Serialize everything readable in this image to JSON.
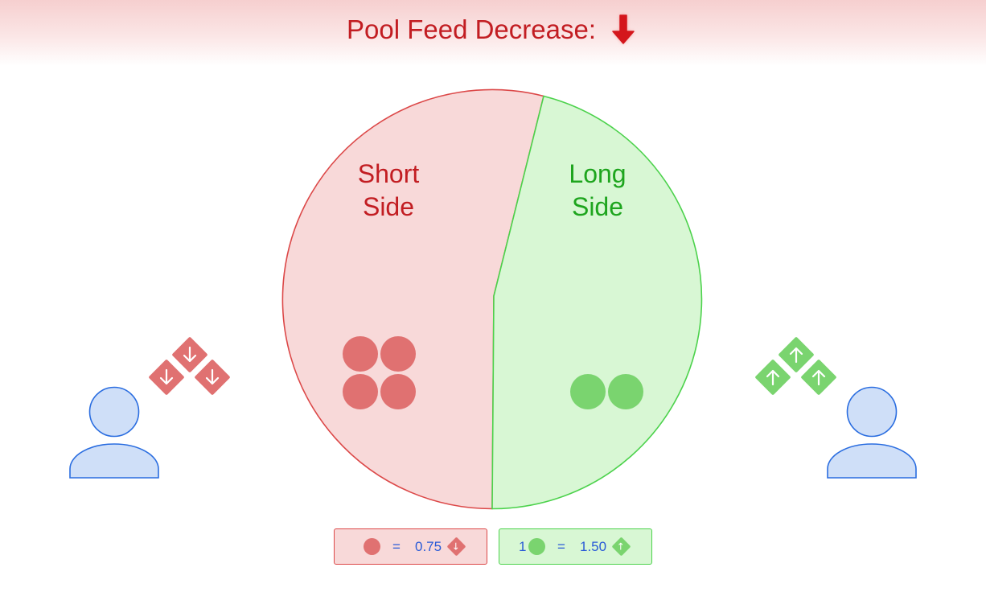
{
  "header": {
    "title": "Pool Feed Decrease:",
    "arrow_icon": "down-arrow-icon",
    "title_color": "#c21d22"
  },
  "pool": {
    "short_side": {
      "label_line1": "Short",
      "label_line2": "Side",
      "token_count": 4,
      "fill": "#f8d9d9",
      "stroke": "#dc4848",
      "text_color": "#c21d22",
      "token_color": "#e07171"
    },
    "long_side": {
      "label_line1": "Long",
      "label_line2": "Side",
      "token_count": 2,
      "fill": "#d8f7d4",
      "stroke": "#4cd24c",
      "text_color": "#1ea51e",
      "token_color": "#7ad46f"
    }
  },
  "traders": {
    "left": {
      "icon": "person-icon",
      "feed_icon": "down-arrow-diamond-icon",
      "feed_count": 3
    },
    "right": {
      "icon": "person-icon",
      "feed_icon": "up-arrow-diamond-icon",
      "feed_count": 3
    }
  },
  "legend": {
    "short": {
      "prefix": "",
      "equals": "=",
      "value": "0.75",
      "icon": "down-arrow-diamond-icon"
    },
    "long": {
      "prefix": "1",
      "equals": "=",
      "value": "1.50",
      "icon": "up-arrow-diamond-icon"
    }
  },
  "colors": {
    "person_fill": "#cfdff8",
    "person_stroke": "#2a6de0",
    "short_diamond": "#e07171",
    "long_diamond": "#7ad46f"
  }
}
